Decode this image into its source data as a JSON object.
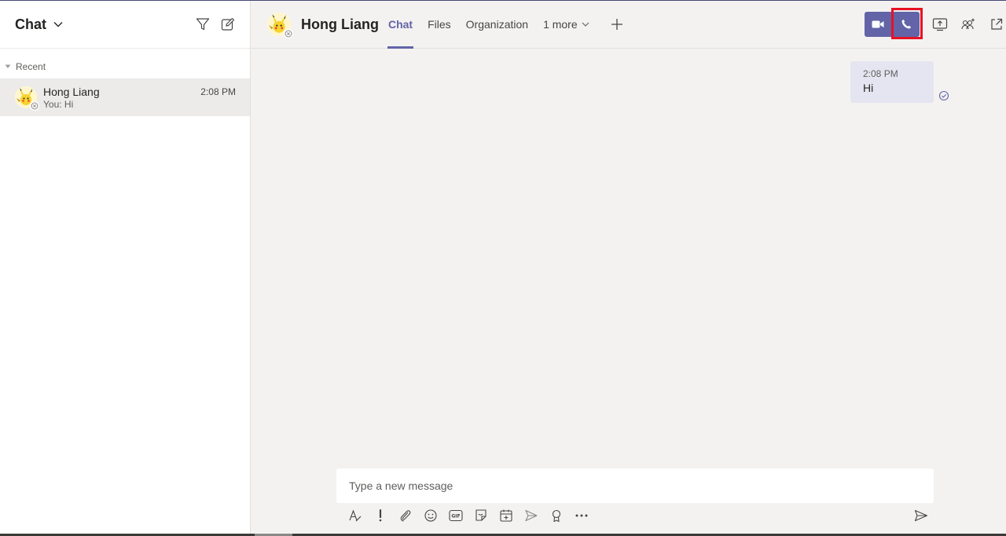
{
  "sidebar": {
    "title": "Chat",
    "section_label": "Recent",
    "chats": [
      {
        "name": "Hong Liang",
        "preview": "You: Hi",
        "time": "2:08 PM"
      }
    ]
  },
  "header": {
    "contact_name": "Hong Liang",
    "tabs": [
      {
        "label": "Chat",
        "active": true
      },
      {
        "label": "Files",
        "active": false
      },
      {
        "label": "Organization",
        "active": false
      },
      {
        "label": "1 more",
        "active": false
      }
    ]
  },
  "messages": [
    {
      "time": "2:08 PM",
      "text": "Hi",
      "status": "read"
    }
  ],
  "composer": {
    "placeholder": "Type a new message"
  },
  "colors": {
    "accent": "#6264a7",
    "highlight": "#e81123",
    "message_bubble": "#e5e5f1",
    "background": "#f3f2f1"
  },
  "icons": {
    "header": [
      "filter-icon",
      "compose-icon"
    ],
    "call": [
      "video-call-icon",
      "audio-call-icon"
    ],
    "right_tools": [
      "share-screen-icon",
      "add-people-icon",
      "pop-out-icon"
    ],
    "toolbar": [
      "format-icon",
      "important-icon",
      "attach-icon",
      "emoji-icon",
      "gif-icon",
      "sticker-icon",
      "schedule-meeting-icon",
      "stream-icon",
      "praise-icon",
      "more-options-icon"
    ],
    "send": "send-icon"
  }
}
